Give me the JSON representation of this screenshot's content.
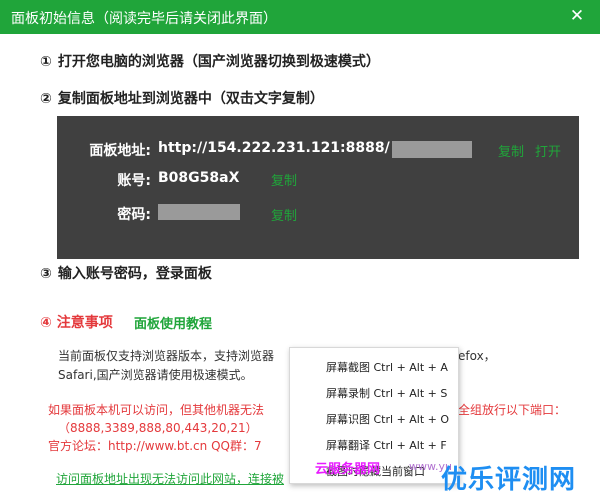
{
  "window": {
    "title": "面板初始信息（阅读完毕后请关闭此界面）",
    "close_icon": "close-icon"
  },
  "steps": [
    {
      "num": "①",
      "text": "打开您电脑的浏览器（国产浏览器切换到极速模式）"
    },
    {
      "num": "②",
      "text": "复制面板地址到浏览器中（双击文字复制）"
    },
    {
      "num": "③",
      "text": "输入账号密码，登录面板"
    }
  ],
  "panel": {
    "address_label": "面板地址:",
    "address_value": "http://154.222.231.121:8888/",
    "copy_label": "复制",
    "open_label": "打开",
    "account_label": "账号:",
    "account_value": "B08G58aX",
    "password_label": "密码:"
  },
  "notice": {
    "num": "④",
    "title": "注意事项",
    "tutorial_link": "面板使用教程",
    "support_line1": "当前面板仅支持浏览器版本，支持浏览器",
    "support_line1_tail": "efox，",
    "support_line2": "Safari,国产浏览器请使用极速模式。",
    "red_line1": "如果面板本机可以访问，但其他机器无法",
    "red_line1_tail": "全组放行以下端口：",
    "red_line2": "（8888,3389,888,80,443,20,21）",
    "red_line3": "官方论坛：http://www.bt.cn  QQ群：7",
    "bottom_link": "访问面板地址出现无法访问此网站，连接被"
  },
  "context_menu": {
    "items": [
      {
        "label": "屏幕截图 Ctrl + Alt + A",
        "checked": false
      },
      {
        "label": "屏幕录制 Ctrl + Alt + S",
        "checked": false
      },
      {
        "label": "屏幕识图 Ctrl + Alt + O",
        "checked": false
      },
      {
        "label": "屏幕翻译 Ctrl + Alt + F",
        "checked": false
      },
      {
        "label": "截图时隐藏当前窗口",
        "checked": true
      }
    ]
  },
  "watermark": {
    "brand": "优乐评测网",
    "small": "云服务器网",
    "url": "www.yu"
  },
  "colors": {
    "accent": "#20a53a",
    "panel_bg": "#404040",
    "warning": "#e4393c"
  }
}
